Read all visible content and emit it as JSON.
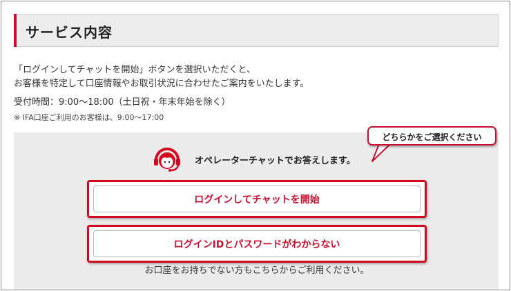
{
  "section": {
    "title": "サービス内容"
  },
  "intro": {
    "line1": "「ログインしてチャットを開始」ボタンを選択いただくと、",
    "line2": "お客様を特定して口座情報やお取引状況に合わせたご案内をいたします。",
    "hours": "受付時間：9:00～18:00（土日祝・年末年始を除く）",
    "note": "※ IFA口座ご利用のお客様は、9:00～17:00"
  },
  "chat": {
    "operator_text": "オペレーターチャットでお答えします。",
    "callout": "どちらかをご選択ください",
    "login_button": "ログインしてチャットを開始",
    "forgot_button": "ログインIDとパスワードがわからない",
    "sub_note": "お口座をお持ちでない方もこちらからご利用ください。"
  },
  "colors": {
    "accent_red": "#c8102e",
    "panel_gray": "#ebebeb"
  },
  "icons": {
    "operator": "operator-headset-icon"
  }
}
